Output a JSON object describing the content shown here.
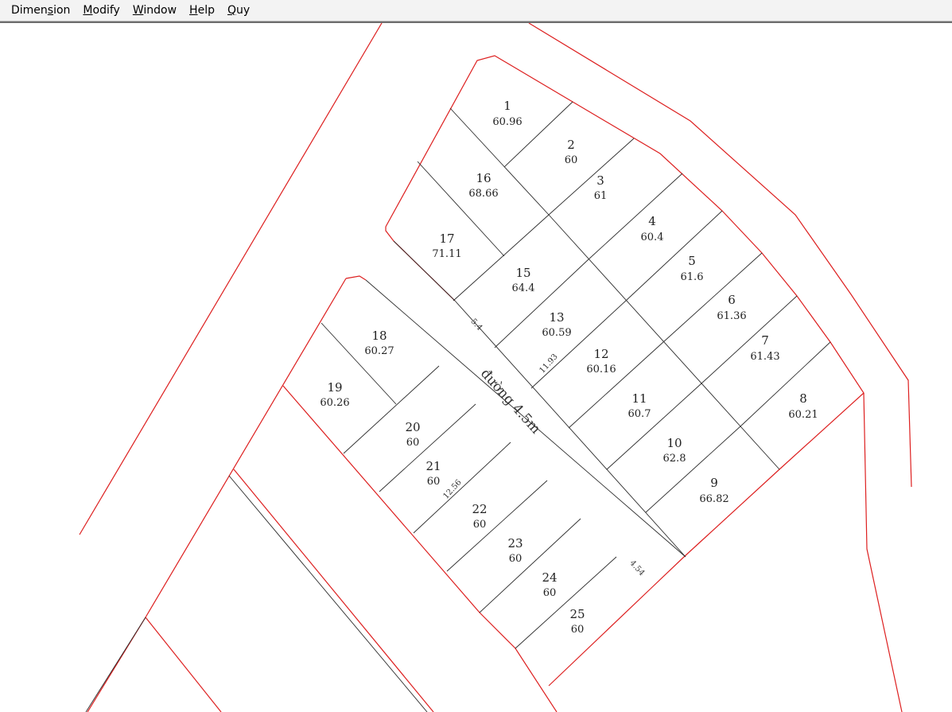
{
  "menu": [
    {
      "label": "Dimension",
      "accel_index": 5
    },
    {
      "label": "Modify",
      "accel_index": 0
    },
    {
      "label": "Window",
      "accel_index": 0
    },
    {
      "label": "Help",
      "accel_index": 0
    },
    {
      "label": "Quy",
      "accel_index": 0
    }
  ],
  "colors": {
    "boundary": "#dd1f1f",
    "lot_line": "#2b2b2b",
    "background": "#ffffff"
  },
  "lots": [
    {
      "no": "1",
      "area": "60.96"
    },
    {
      "no": "2",
      "area": "60"
    },
    {
      "no": "3",
      "area": "61"
    },
    {
      "no": "4",
      "area": "60.4"
    },
    {
      "no": "5",
      "area": "61.6"
    },
    {
      "no": "6",
      "area": "61.36"
    },
    {
      "no": "7",
      "area": "61.43"
    },
    {
      "no": "8",
      "area": "60.21"
    },
    {
      "no": "9",
      "area": "66.82"
    },
    {
      "no": "10",
      "area": "62.8"
    },
    {
      "no": "11",
      "area": "60.7"
    },
    {
      "no": "12",
      "area": "60.16"
    },
    {
      "no": "13",
      "area": "60.59"
    },
    {
      "no": "15",
      "area": "64.4"
    },
    {
      "no": "16",
      "area": "68.66"
    },
    {
      "no": "17",
      "area": "71.11"
    },
    {
      "no": "18",
      "area": "60.27"
    },
    {
      "no": "19",
      "area": "60.26"
    },
    {
      "no": "20",
      "area": "60"
    },
    {
      "no": "21",
      "area": "60"
    },
    {
      "no": "22",
      "area": "60"
    },
    {
      "no": "23",
      "area": "60"
    },
    {
      "no": "24",
      "area": "60"
    },
    {
      "no": "25",
      "area": "60"
    }
  ],
  "dimensions": [
    "5.4",
    "11.93",
    "12.56",
    "4.54"
  ],
  "road_label": "đường 4.5m"
}
